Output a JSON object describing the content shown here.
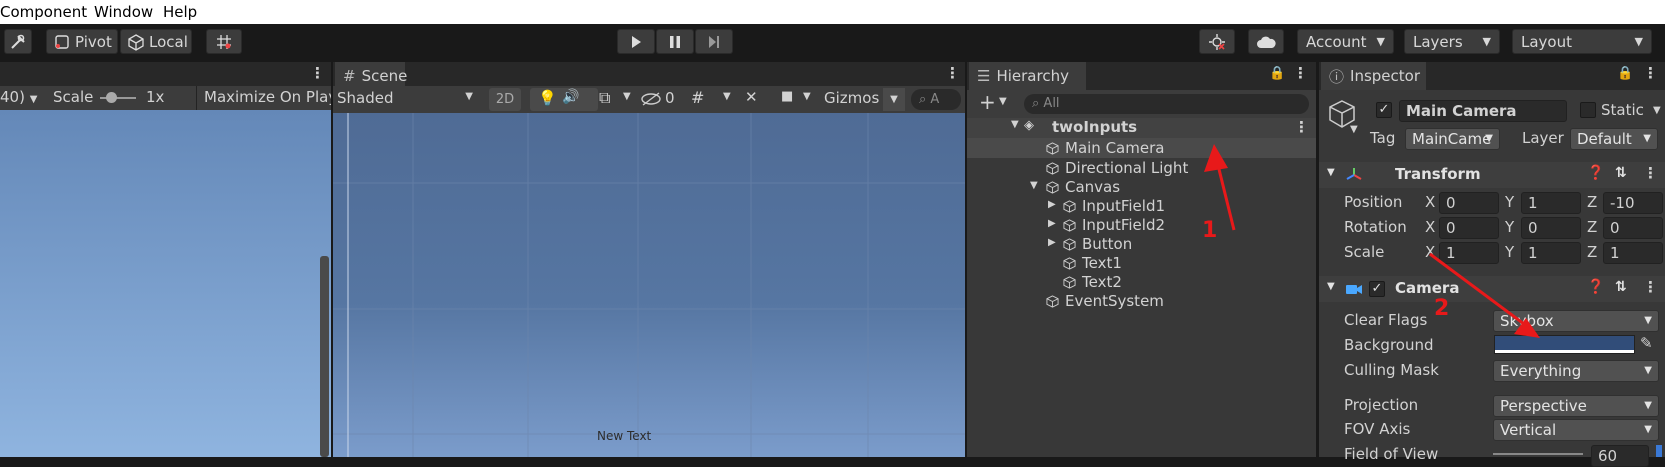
{
  "menu": [
    "Component",
    "Window",
    "Help"
  ],
  "toolbar": {
    "pivot": "Pivot",
    "local": "Local",
    "account": "Account",
    "layers": "Layers",
    "layout": "Layout"
  },
  "game": {
    "resolution": "40)",
    "scale_label": "Scale",
    "scale_value": "1x",
    "maximize": "Maximize On Play"
  },
  "scene": {
    "tab": "Scene",
    "shading": "Shaded",
    "mode_2d": "2D",
    "hidden_count": "0",
    "gizmos": "Gizmos",
    "search_placeholder": "A",
    "canvas_text": "New Text"
  },
  "hierarchy": {
    "tab": "Hierarchy",
    "search_placeholder": "All",
    "scene_name": "twoInputs",
    "items": [
      "Main Camera",
      "Directional Light",
      "Canvas",
      "InputField1",
      "InputField2",
      "Button",
      "Text1",
      "Text2",
      "EventSystem"
    ]
  },
  "inspector": {
    "tab": "Inspector",
    "object_name": "Main Camera",
    "static_label": "Static",
    "tag_label": "Tag",
    "tag_value": "MainCame",
    "layer_label": "Layer",
    "layer_value": "Default",
    "transform": {
      "title": "Transform",
      "position_label": "Position",
      "rotation_label": "Rotation",
      "scale_label": "Scale",
      "position": [
        "0",
        "1",
        "-10"
      ],
      "rotation": [
        "0",
        "0",
        "0"
      ],
      "scale": [
        "1",
        "1",
        "1"
      ],
      "axes": [
        "X",
        "Y",
        "Z"
      ]
    },
    "camera": {
      "title": "Camera",
      "clear_flags_label": "Clear Flags",
      "clear_flags_value": "Skybox",
      "background_label": "Background",
      "background_color": "#314d79",
      "culling_mask_label": "Culling Mask",
      "culling_mask_value": "Everything",
      "projection_label": "Projection",
      "projection_value": "Perspective",
      "fov_axis_label": "FOV Axis",
      "fov_axis_value": "Vertical",
      "fov_label": "Field of View",
      "fov_value": "60"
    }
  },
  "annotations": [
    "1",
    "2"
  ],
  "colors": {
    "annotation_red": "#e8191a",
    "sky_top": "#4e6a94",
    "sky_bottom": "#8fb4df"
  }
}
